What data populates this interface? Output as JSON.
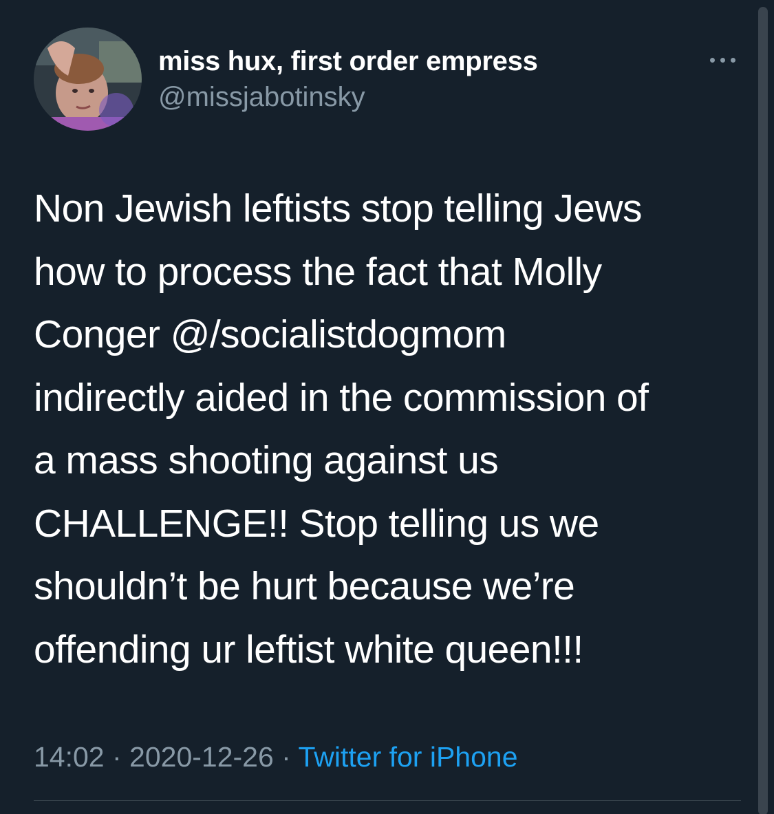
{
  "author": {
    "display_name": "miss hux, first order empress",
    "handle": "@missjabotinsky",
    "avatar_icon": "profile-photo"
  },
  "more_icon": "more-options-icon",
  "tweet": {
    "lines": [
      "Non Jewish leftists stop telling Jews",
      "how to process the fact that Molly",
      "Conger @/socialistdogmom",
      "indirectly aided in the commission of",
      "a mass shooting against us",
      "CHALLENGE!! Stop telling us we",
      "shouldn’t be hurt because we’re",
      "offending ur leftist white queen!!!"
    ]
  },
  "meta": {
    "time": "14:02",
    "separator": " · ",
    "date": "2020-12-26",
    "source": "Twitter for iPhone"
  },
  "colors": {
    "background": "#15202b",
    "primary_text": "#ffffff",
    "secondary_text": "#8899a6",
    "link": "#1da1f2"
  }
}
